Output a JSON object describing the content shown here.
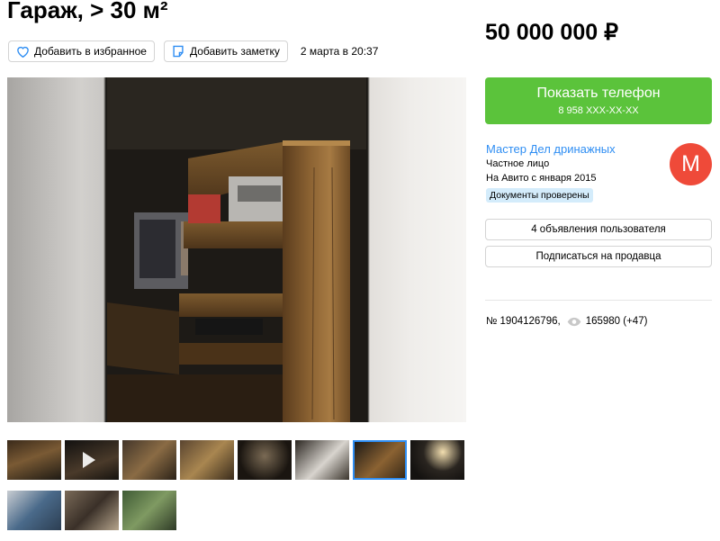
{
  "listing": {
    "title": "Гараж, > 30 м²",
    "price": "50 000 000 ₽",
    "date": "2 марта в 20:37"
  },
  "actions": {
    "favorite_label": "Добавить в избранное",
    "note_label": "Добавить заметку"
  },
  "contact": {
    "show_phone_label": "Показать телефон",
    "phone_masked": "8 958 XXX-XX-XX"
  },
  "seller": {
    "name": "Мастер Дел дринажных",
    "type": "Частное лицо",
    "since": "На Авито с января 2015",
    "verified_badge": "Документы проверены",
    "avatar_letter": "М",
    "listings_button": "4 объявления пользователя",
    "subscribe_button": "Подписаться на продавца"
  },
  "meta": {
    "listing_number": "№ 1904126796,",
    "views": "165980 (+47)"
  },
  "icons": {
    "favorite": "heart-icon",
    "note": "note-icon",
    "views": "eye-icon",
    "video": "play-icon"
  },
  "colors": {
    "accent_green": "#5bc33b",
    "link_blue": "#2f8ef3",
    "avatar_red": "#ef4a39",
    "badge_bg": "#d4ecfb"
  }
}
